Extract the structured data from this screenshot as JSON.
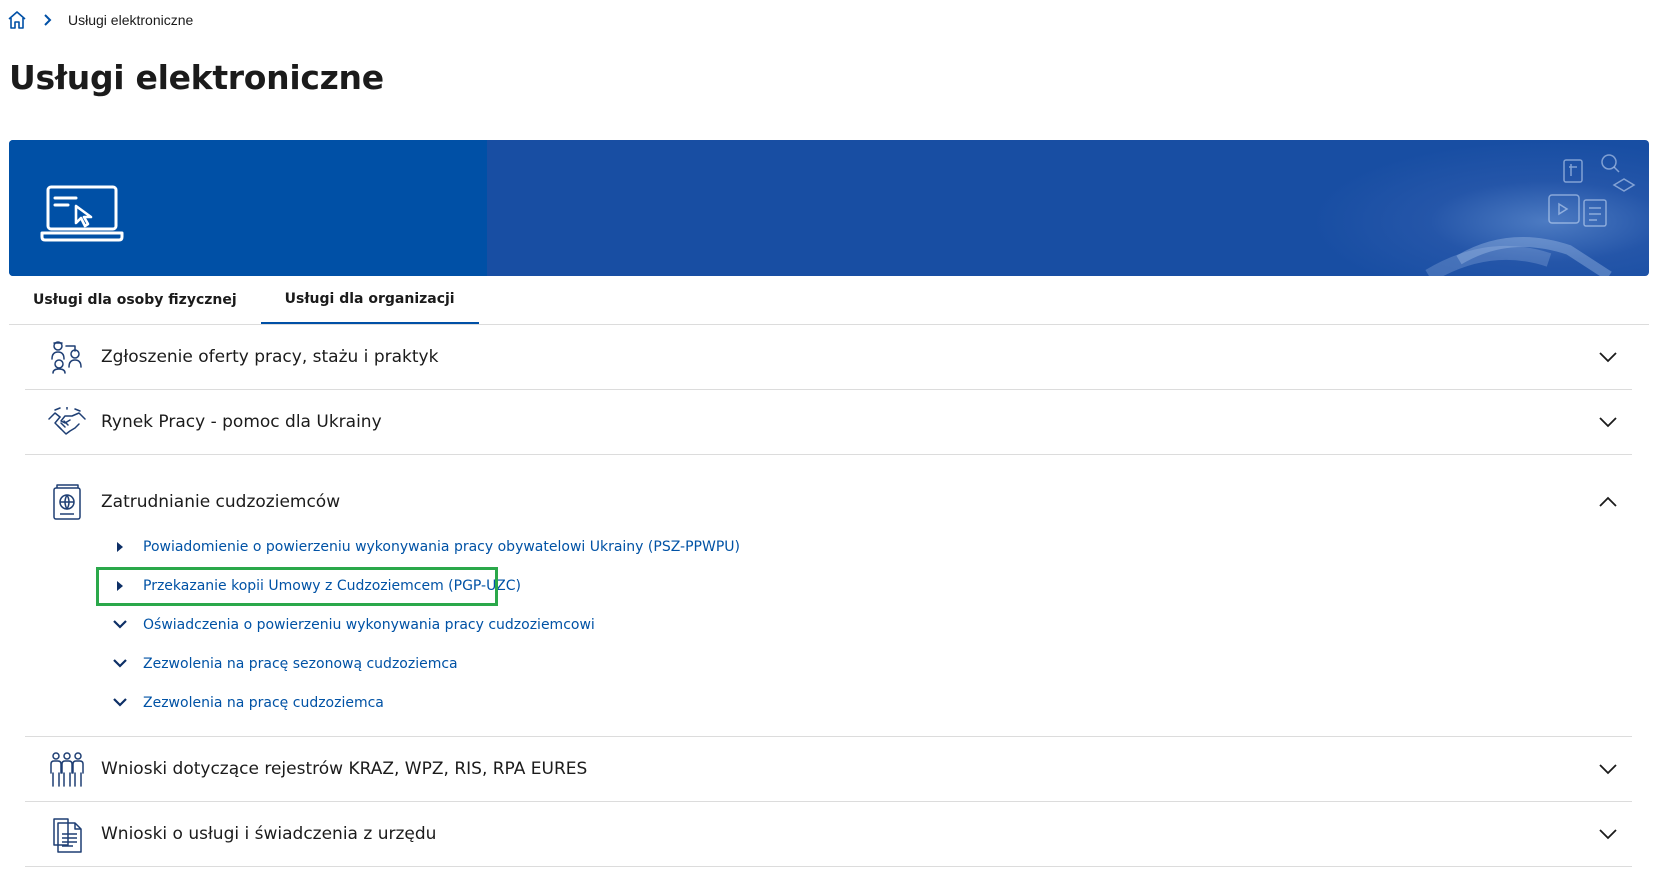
{
  "breadcrumb": {
    "home_icon": "home-icon",
    "separator_icon": "chevron-right-icon",
    "current": "Usługi elektroniczne"
  },
  "page": {
    "title": "Usługi elektroniczne"
  },
  "banner": {
    "icon": "laptop-cursor-icon",
    "left_color": "#0050a6",
    "right_color": "#184ea3"
  },
  "tabs": [
    {
      "label": "Usługi dla osoby fizycznej",
      "active": false
    },
    {
      "label": "Usługi dla organizacji",
      "active": true
    }
  ],
  "accordion": {
    "items": [
      {
        "icon": "people-offer-icon",
        "title": "Zgłoszenie oferty pracy, stażu i praktyk",
        "expanded": false
      },
      {
        "icon": "handshake-icon",
        "title": "Rynek Pracy - pomoc dla Ukrainy",
        "expanded": false
      },
      {
        "icon": "passport-globe-icon",
        "title": "Zatrudnianie cudzoziemców",
        "expanded": true,
        "children": [
          {
            "icon": "caret-right-icon",
            "label": "Powiadomienie o powierzeniu wykonywania pracy obywatelowi Ukrainy (PSZ-PPWPU)"
          },
          {
            "icon": "caret-right-icon",
            "label": "Przekazanie kopii Umowy z Cudzoziemcem (PGP-UZC)",
            "highlighted": true
          },
          {
            "icon": "chevron-down-icon",
            "label": "Oświadczenia o powierzeniu wykonywania pracy cudzoziemcowi"
          },
          {
            "icon": "chevron-down-icon",
            "label": "Zezwolenia na pracę sezonową cudzoziemca"
          },
          {
            "icon": "chevron-down-icon",
            "label": "Zezwolenia na pracę cudzoziemca"
          }
        ]
      },
      {
        "icon": "group-people-icon",
        "title": "Wnioski dotyczące rejestrów KRAZ, WPZ, RIS, RPA EURES",
        "expanded": false
      },
      {
        "icon": "documents-icon",
        "title": "Wnioski o usługi i świadczenia z urzędu",
        "expanded": false
      }
    ]
  },
  "colors": {
    "link": "#0052a5",
    "highlight": "#2aa84a",
    "divider": "#dcdcdc"
  }
}
